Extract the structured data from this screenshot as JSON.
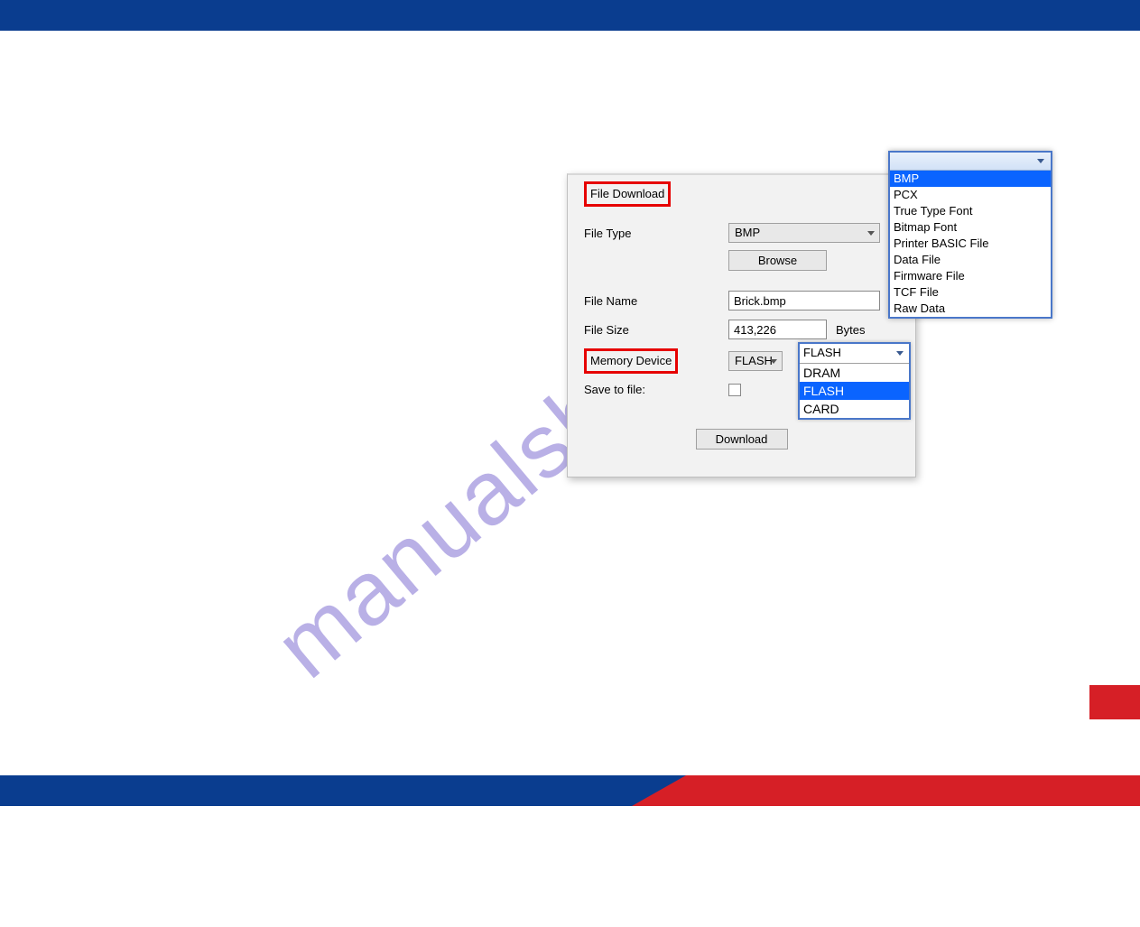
{
  "watermark": "manualshive.com",
  "dialog": {
    "group_title": "File Download",
    "file_type_label": "File Type",
    "file_type_value": "BMP",
    "browse_label": "Browse",
    "file_name_label": "File Name",
    "file_name_value": "Brick.bmp",
    "file_size_label": "File Size",
    "file_size_value": "413,226",
    "bytes_label": "Bytes",
    "memory_device_label": "Memory Device",
    "memory_device_value": "FLASH",
    "save_to_file_label": "Save to file:",
    "download_label": "Download"
  },
  "filetype_dropdown": {
    "selected": "BMP",
    "options": [
      "BMP",
      "PCX",
      "True Type Font",
      "Bitmap Font",
      "Printer BASIC File",
      "Data File",
      "Firmware File",
      "TCF File",
      "Raw Data"
    ]
  },
  "memory_dropdown": {
    "header_value": "FLASH",
    "selected": "FLASH",
    "options": [
      "DRAM",
      "FLASH",
      "CARD"
    ]
  }
}
